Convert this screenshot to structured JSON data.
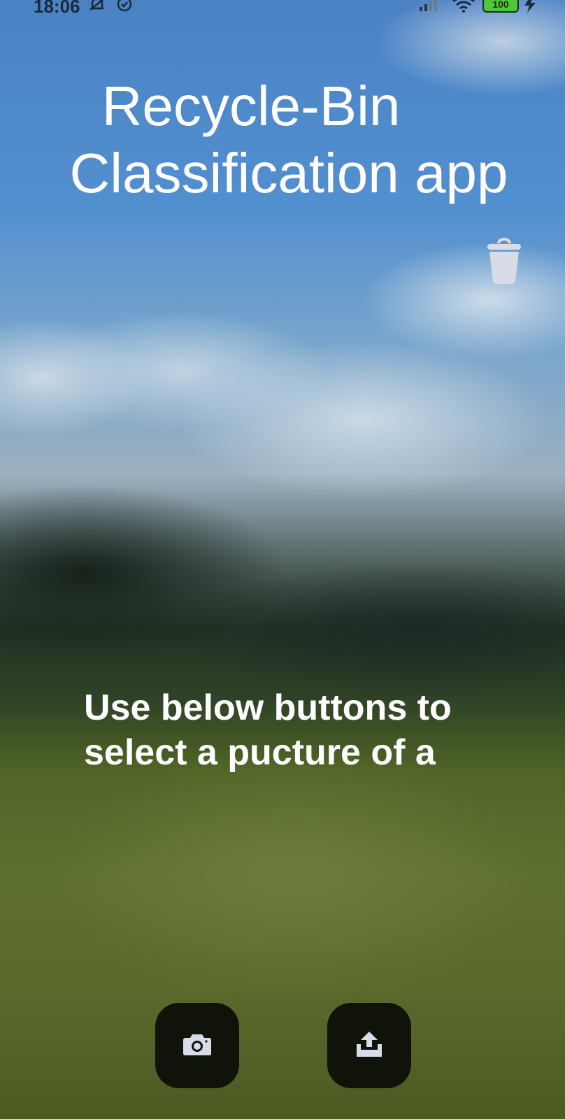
{
  "status_bar": {
    "time": "18:06",
    "battery": "100",
    "icons": [
      "notifications-off-icon",
      "alarm-icon",
      "signal-icon",
      "wifi-icon",
      "battery-icon",
      "charging-icon"
    ]
  },
  "app": {
    "title_line1": "Recycle-Bin",
    "title_line2": "Classification app",
    "instruction_line1": "Use below buttons to",
    "instruction_line2": "select a pucture of a"
  },
  "actions": {
    "camera_icon": "camera-icon",
    "upload_icon": "upload-icon"
  },
  "colors": {
    "title_text": "#ffffff",
    "button_bg": "#0f130a",
    "icon_light": "#d8dce6"
  }
}
